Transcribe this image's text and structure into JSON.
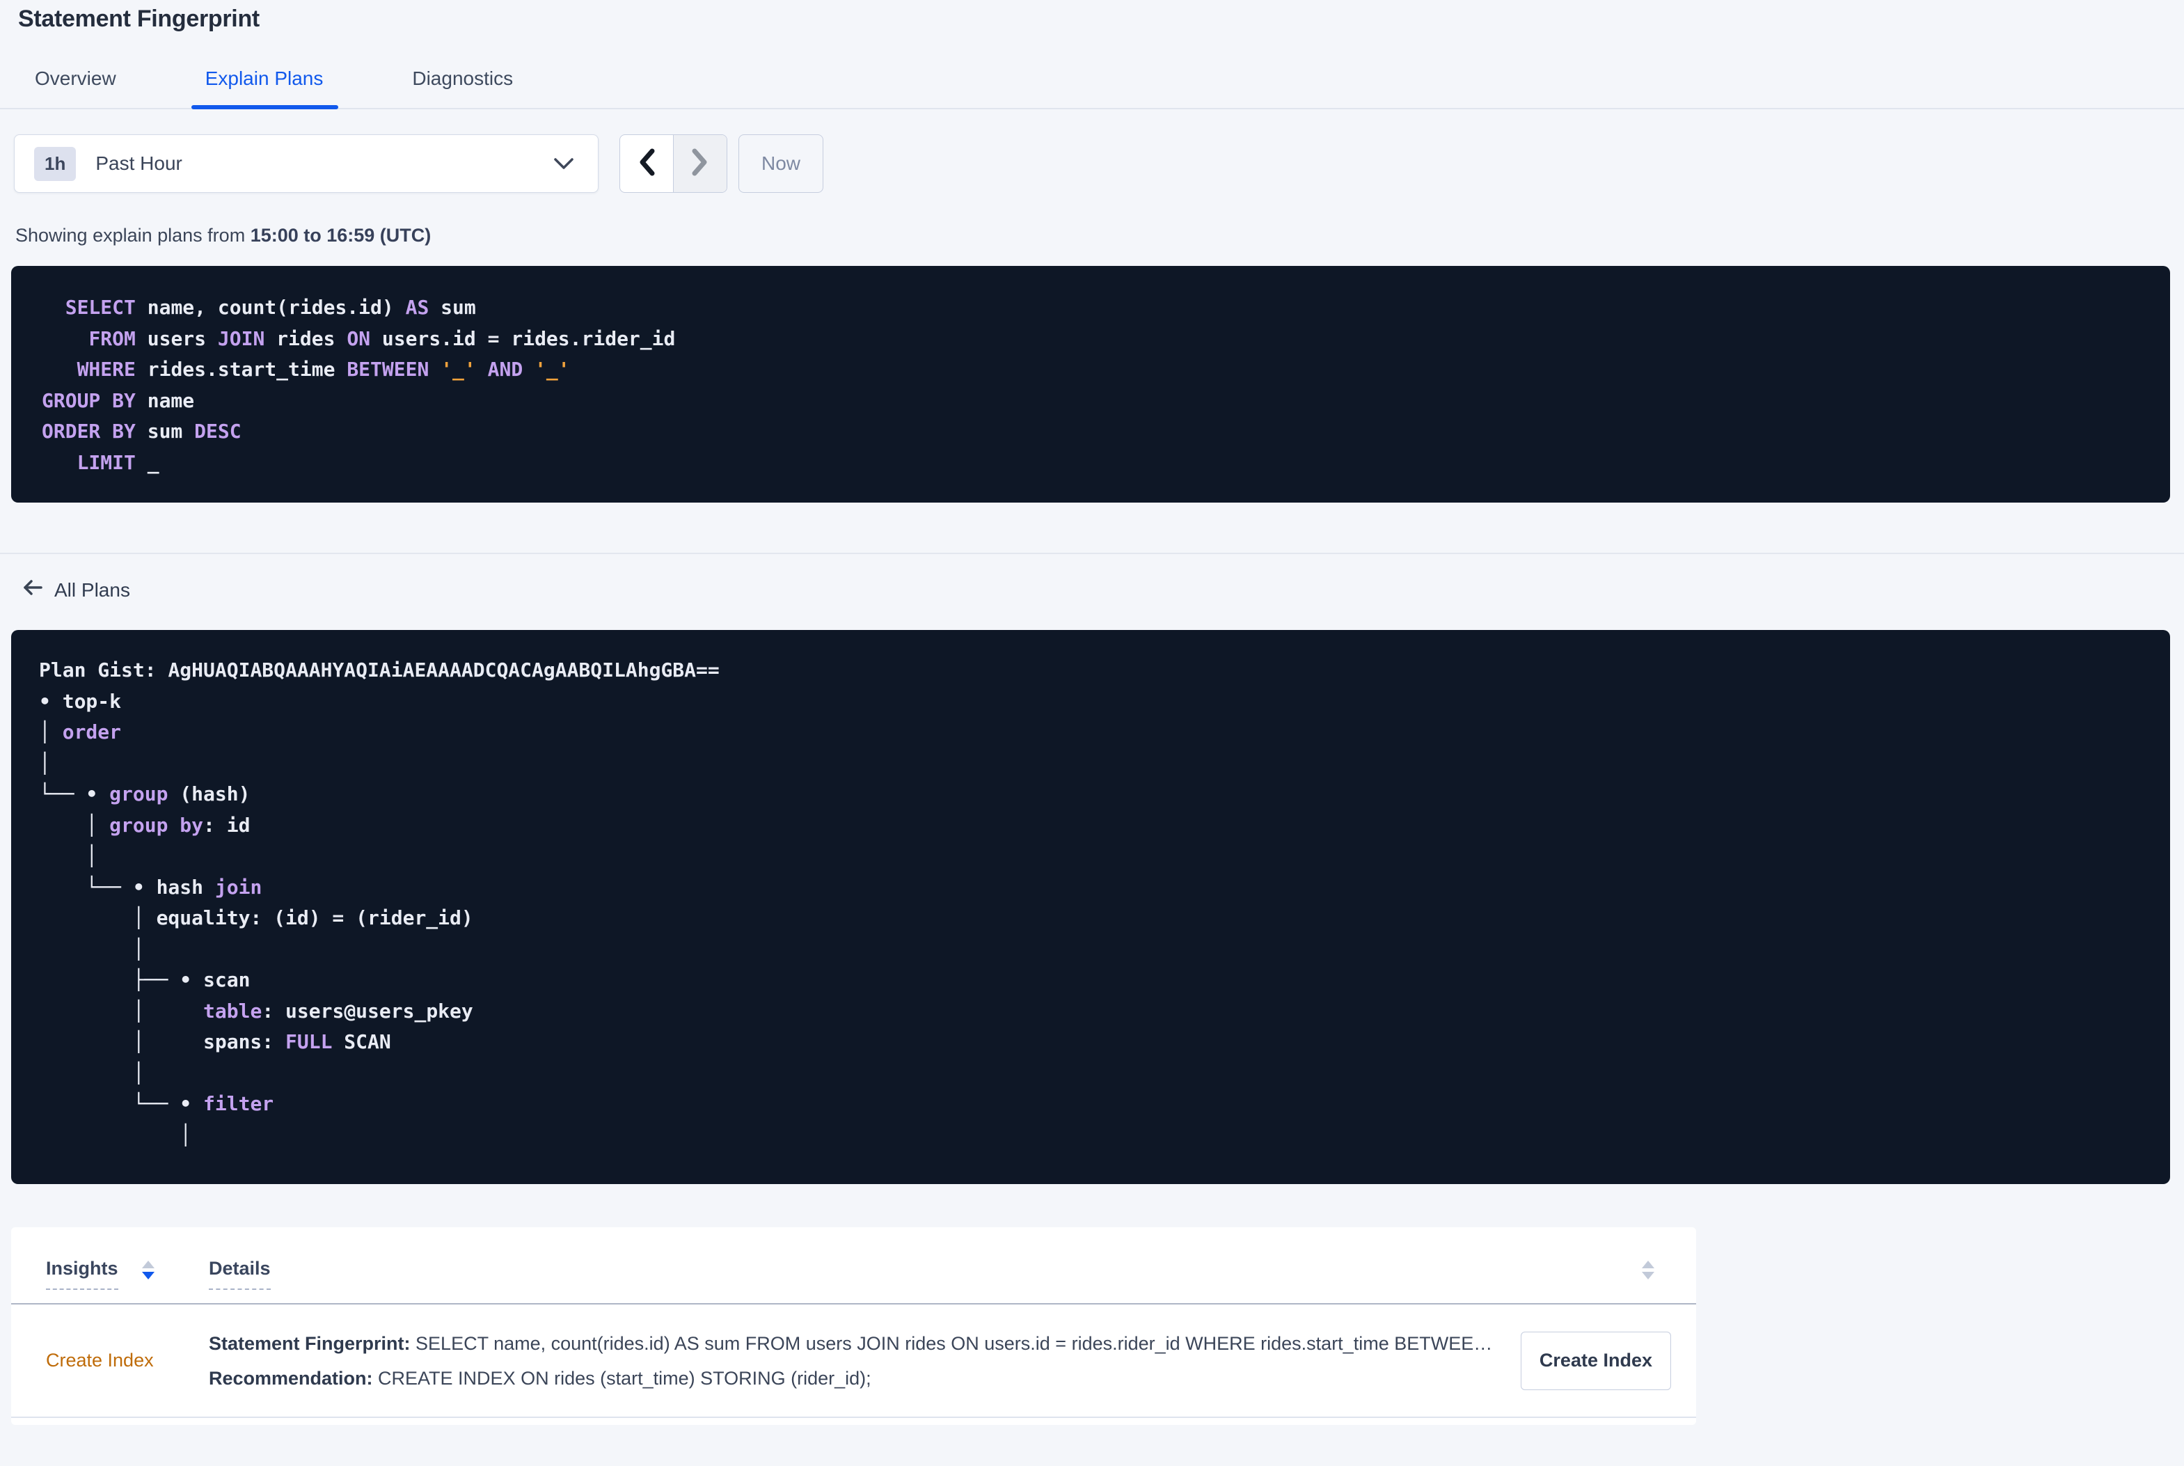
{
  "page": {
    "title": "Statement Fingerprint"
  },
  "tabs": {
    "items": [
      {
        "label": "Overview"
      },
      {
        "label": "Explain Plans"
      },
      {
        "label": "Diagnostics"
      }
    ],
    "active": "Explain Plans"
  },
  "time_controls": {
    "interval_badge": "1h",
    "selected_range": "Past Hour",
    "now_label": "Now"
  },
  "caption": {
    "prefix": "Showing explain plans from ",
    "range_bold": "15:00 to 16:59 (UTC)"
  },
  "sql": {
    "lines": [
      [
        {
          "c": "w",
          "t": "  "
        },
        {
          "c": "k",
          "t": "SELECT"
        },
        {
          "c": "w",
          "t": " name, count(rides.id) "
        },
        {
          "c": "k",
          "t": "AS"
        },
        {
          "c": "w",
          "t": " sum"
        }
      ],
      [
        {
          "c": "w",
          "t": "    "
        },
        {
          "c": "k",
          "t": "FROM"
        },
        {
          "c": "w",
          "t": " users "
        },
        {
          "c": "k",
          "t": "JOIN"
        },
        {
          "c": "w",
          "t": " rides "
        },
        {
          "c": "k",
          "t": "ON"
        },
        {
          "c": "w",
          "t": " users.id = rides.rider_id"
        }
      ],
      [
        {
          "c": "w",
          "t": "   "
        },
        {
          "c": "k",
          "t": "WHERE"
        },
        {
          "c": "w",
          "t": " rides.start_time "
        },
        {
          "c": "k",
          "t": "BETWEEN"
        },
        {
          "c": "w",
          "t": " "
        },
        {
          "c": "o",
          "t": "'_'"
        },
        {
          "c": "w",
          "t": " "
        },
        {
          "c": "k",
          "t": "AND"
        },
        {
          "c": "w",
          "t": " "
        },
        {
          "c": "o",
          "t": "'_'"
        }
      ],
      [
        {
          "c": "k",
          "t": "GROUP BY"
        },
        {
          "c": "w",
          "t": " name"
        }
      ],
      [
        {
          "c": "k",
          "t": "ORDER BY"
        },
        {
          "c": "w",
          "t": " sum "
        },
        {
          "c": "k",
          "t": "DESC"
        }
      ],
      [
        {
          "c": "w",
          "t": "   "
        },
        {
          "c": "k",
          "t": "LIMIT"
        },
        {
          "c": "w",
          "t": " _"
        }
      ]
    ]
  },
  "plans_nav": {
    "back_label": "All Plans"
  },
  "plan_gist": {
    "label": "Plan Gist: ",
    "value": "AgHUAQIABQAAAHYAQIAiAEAAAADCQACAgAABQILAhgGBA=="
  },
  "plan_tree": {
    "lines": [
      [
        {
          "c": "w",
          "t": "• top-k"
        }
      ],
      [
        {
          "c": "w",
          "t": "│ "
        },
        {
          "c": "k",
          "t": "order"
        }
      ],
      [
        {
          "c": "w",
          "t": "│"
        }
      ],
      [
        {
          "c": "w",
          "t": "└── • "
        },
        {
          "c": "k",
          "t": "group"
        },
        {
          "c": "w",
          "t": " (hash)"
        }
      ],
      [
        {
          "c": "w",
          "t": "    │ "
        },
        {
          "c": "k",
          "t": "group by"
        },
        {
          "c": "w",
          "t": ": id"
        }
      ],
      [
        {
          "c": "w",
          "t": "    │"
        }
      ],
      [
        {
          "c": "w",
          "t": "    └── • hash "
        },
        {
          "c": "k",
          "t": "join"
        }
      ],
      [
        {
          "c": "w",
          "t": "        │ equality: (id) = (rider_id)"
        }
      ],
      [
        {
          "c": "w",
          "t": "        │"
        }
      ],
      [
        {
          "c": "w",
          "t": "        ├── • scan"
        }
      ],
      [
        {
          "c": "w",
          "t": "        │     "
        },
        {
          "c": "k",
          "t": "table"
        },
        {
          "c": "w",
          "t": ": users@users_pkey"
        }
      ],
      [
        {
          "c": "w",
          "t": "        │     spans: "
        },
        {
          "c": "k",
          "t": "FULL"
        },
        {
          "c": "w",
          "t": " SCAN"
        }
      ],
      [
        {
          "c": "w",
          "t": "        │"
        }
      ],
      [
        {
          "c": "w",
          "t": "        └── • "
        },
        {
          "c": "k",
          "t": "filter"
        }
      ],
      [
        {
          "c": "w",
          "t": "            │"
        }
      ]
    ]
  },
  "insights_table": {
    "headers": [
      {
        "label": "Insights",
        "sort": "desc"
      },
      {
        "label": "Details",
        "sort": "none"
      }
    ],
    "rows": [
      {
        "insight": "Create Index",
        "details": [
          {
            "label": "Statement Fingerprint:",
            "text": "SELECT name, count(rides.id) AS sum FROM users JOIN rides ON users.id = rides.rider_id WHERE rides.start_time BETWEEN '_' AND '_' GROUP BY name ORDER BY sum DESC LIMIT _"
          },
          {
            "label": "Recommendation:",
            "text": "CREATE INDEX ON rides (start_time) STORING (rider_id);"
          }
        ],
        "action_label": "Create Index"
      }
    ]
  },
  "colors": {
    "accent_blue": "#1159ec",
    "insight_orange": "#bf6c0a",
    "code_keyword": "#c4a2ef",
    "code_text": "#e9ecf4",
    "code_literal": "#f0a23c",
    "code_bg": "#0e1726",
    "page_bg": "#f4f6fa"
  }
}
